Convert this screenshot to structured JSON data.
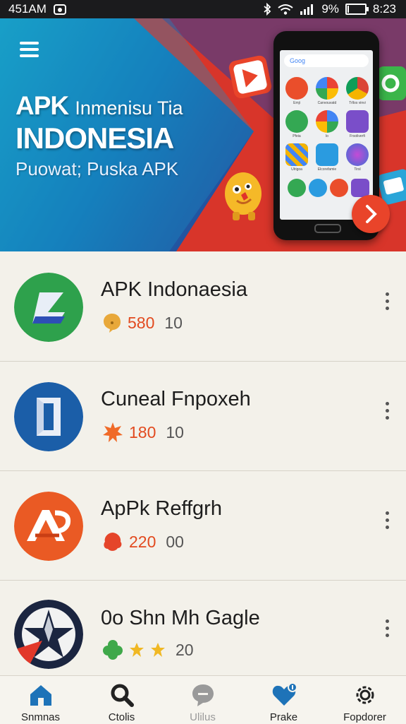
{
  "status_bar": {
    "time_left": "451AM",
    "battery_pct": "9%",
    "battery_level": 0.09,
    "time_right": "8:23"
  },
  "banner": {
    "title": "APK",
    "title_sub": "Inmenisu Tia",
    "headline": "INDONESIA",
    "tagline": "Puowat; Puska APK",
    "phone_search": "Goog",
    "phone_apps": [
      "Emji",
      "Canvouvatd",
      "Trllos vinvi",
      "Pfeia",
      "lo",
      "Frsoliverfi",
      "Ulrigoa",
      "Elcorefamie",
      "Tirsl"
    ]
  },
  "apps": [
    {
      "name": "APK Indonaesia",
      "rating": "580",
      "count": "10",
      "accent": "#e8a83a"
    },
    {
      "name": "Cuneal Fnpoxeh",
      "rating": "180",
      "count": "10",
      "accent": "#f06a28"
    },
    {
      "name": "ApPk Reffgrh",
      "rating": "220",
      "count": "00",
      "accent": "#e5452a"
    },
    {
      "name": "0o Shn Mh Gagle",
      "rating": "",
      "count": "20",
      "accent": "#3fa84a"
    }
  ],
  "bottom_nav": [
    {
      "label": "Snmnas",
      "icon": "home-icon",
      "color": "#1e73b8"
    },
    {
      "label": "Ctolis",
      "icon": "search-icon",
      "color": "#222222"
    },
    {
      "label": "Ulilus",
      "icon": "chat-icon",
      "color": "#9a9a9a"
    },
    {
      "label": "Prake",
      "icon": "heart-icon",
      "color": "#1e73b8"
    },
    {
      "label": "Fopdorer",
      "icon": "gear-icon",
      "color": "#222222"
    }
  ]
}
